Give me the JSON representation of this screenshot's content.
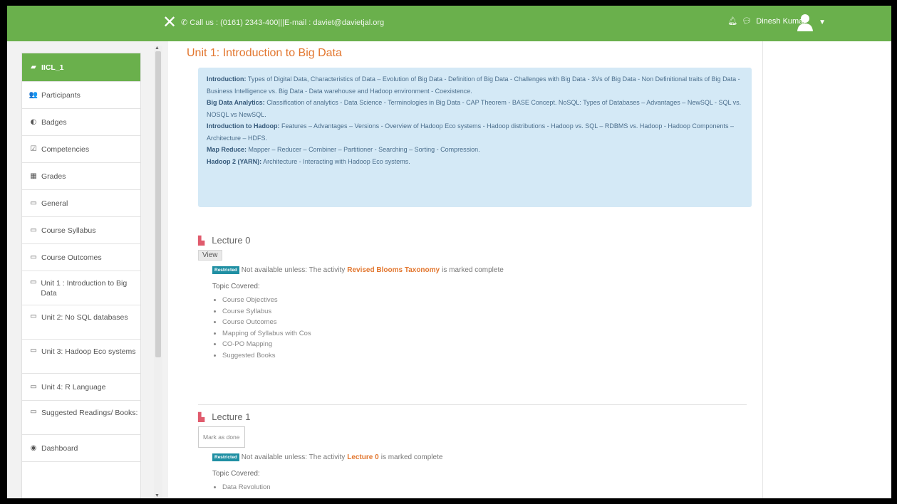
{
  "topbar": {
    "contact": "Call us : (0161) 2343-400|||E-mail : daviet@davietjal.org",
    "user_name": "Dinesh Kumar"
  },
  "sidebar": {
    "items": [
      {
        "icon": "course-icon",
        "glyph": "▰",
        "label": "IICL_1",
        "active": true
      },
      {
        "icon": "participants-icon",
        "glyph": "👥",
        "label": "Participants"
      },
      {
        "icon": "badges-icon",
        "glyph": "◐",
        "label": "Badges"
      },
      {
        "icon": "competencies-icon",
        "glyph": "☑",
        "label": "Competencies"
      },
      {
        "icon": "grades-icon",
        "glyph": "▦",
        "label": "Grades"
      },
      {
        "icon": "folder-icon",
        "glyph": "▭",
        "label": "General"
      },
      {
        "icon": "folder-icon",
        "glyph": "▭",
        "label": "Course Syllabus"
      },
      {
        "icon": "folder-icon",
        "glyph": "▭",
        "label": "Course Outcomes"
      },
      {
        "icon": "folder-icon",
        "glyph": "▭",
        "label": "Unit 1 : Introduction to Big Data",
        "tall": true
      },
      {
        "icon": "folder-icon",
        "glyph": "▭",
        "label": "Unit 2: No SQL databases",
        "tall": true
      },
      {
        "icon": "folder-icon",
        "glyph": "▭",
        "label": "Unit 3: Hadoop Eco systems",
        "tall": true
      },
      {
        "icon": "folder-icon",
        "glyph": "▭",
        "label": "Unit 4: R Language"
      },
      {
        "icon": "folder-icon",
        "glyph": "▭",
        "label": "Suggested Readings/ Books:",
        "tall": true
      },
      {
        "icon": "dashboard-icon",
        "glyph": "◉",
        "label": "Dashboard"
      }
    ]
  },
  "main": {
    "title": "Unit 1: Introduction to Big Data",
    "summary": [
      {
        "head": "Introduction:",
        "text": " Types of Digital Data, Characteristics of Data – Evolution of Big Data - Definition of Big Data - Challenges with Big Data - 3Vs of Big Data - Non Definitional traits of Big Data - Business Intelligence vs. Big Data - Data warehouse and Hadoop environment - Coexistence."
      },
      {
        "head": "Big Data Analytics:",
        "text": " Classification of analytics - Data Science - Terminologies in Big Data - CAP Theorem - BASE Concept. NoSQL: Types of Databases – Advantages – NewSQL - SQL vs. NOSQL vs NewSQL."
      },
      {
        "head": "Introduction to Hadoop:",
        "text": " Features – Advantages – Versions - Overview of Hadoop Eco systems - Hadoop distributions - Hadoop vs. SQL – RDBMS vs. Hadoop - Hadoop Components – Architecture – HDFS."
      },
      {
        "head": "Map Reduce:",
        "text": " Mapper – Reducer – Combiner – Partitioner - Searching – Sorting - Compression."
      },
      {
        "head": "Hadoop 2 (YARN):",
        "text": " Architecture - Interacting with Hadoop Eco systems."
      }
    ],
    "lectures": [
      {
        "title": "Lecture 0",
        "button": "View",
        "button_kind": "view",
        "badge": "Restricted",
        "restrict_pre": "Not available unless: The activity",
        "restrict_link": "Revised Blooms Taxonomy",
        "restrict_post": "is marked complete",
        "topic_label": "Topic Covered:",
        "topics": [
          "Course Objectives",
          "Course Syllabus",
          "Course Outcomes",
          "Mapping of Syllabus with Cos",
          "CO-PO Mapping",
          "Suggested Books"
        ]
      },
      {
        "title": "Lecture 1",
        "button": "Mark as done",
        "button_kind": "done",
        "badge": "Restricted",
        "restrict_pre": "Not available unless: The activity",
        "restrict_link": "Lecture 0",
        "restrict_post": "is marked complete",
        "topic_label": "Topic Covered:",
        "topics": [
          "Data Revolution"
        ]
      }
    ]
  },
  "colors": {
    "brand": "#6ab04c",
    "title": "#e2762e",
    "summary_bg": "#d4e9f6",
    "badge": "#1f8fa3"
  }
}
